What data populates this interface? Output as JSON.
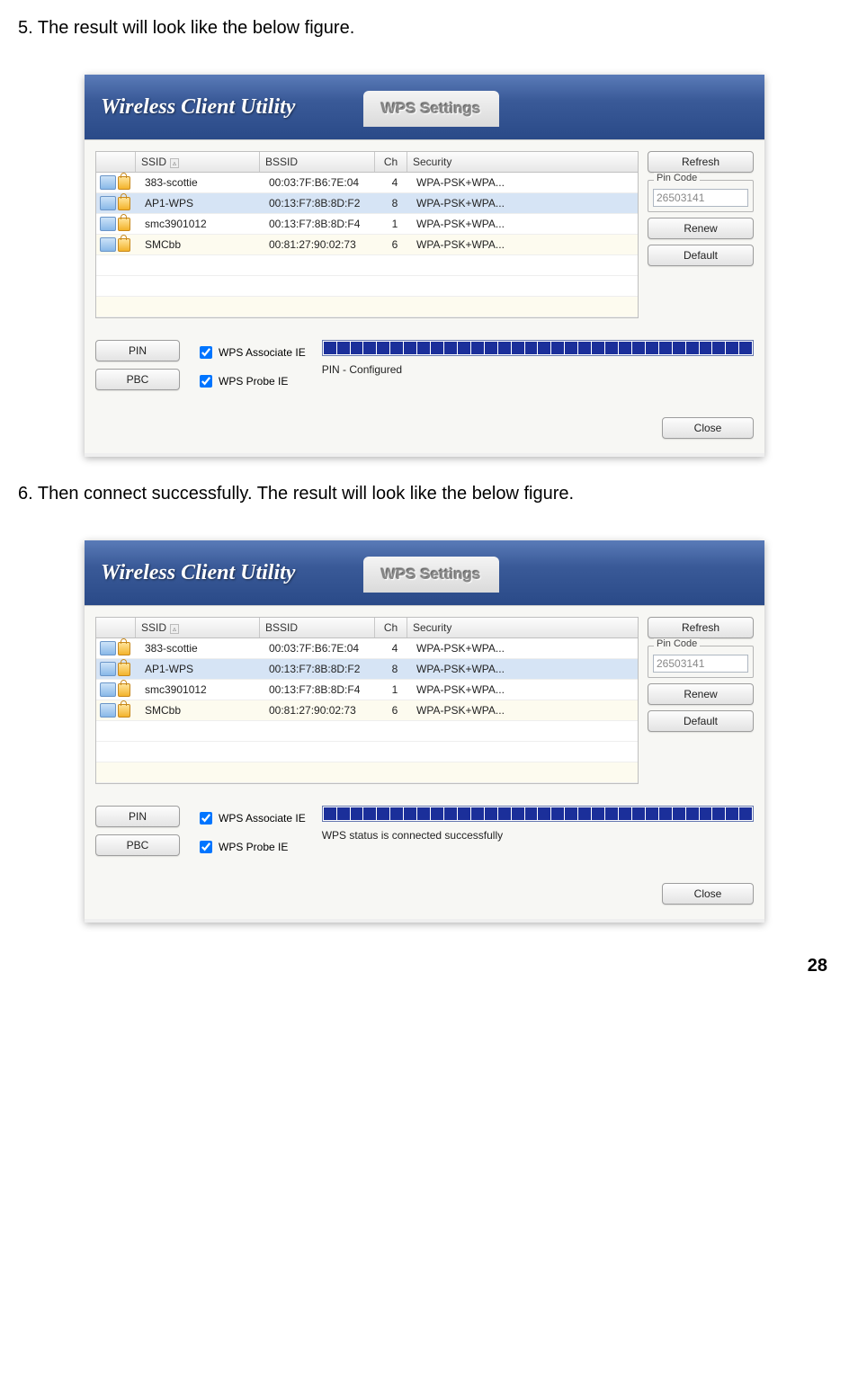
{
  "doc": {
    "step5": "5. The result will look like the below figure.",
    "step6": "6. Then connect successfully. The result will look like the below figure.",
    "page_number": "28"
  },
  "app": {
    "title": "Wireless Client Utility",
    "tab": "WPS Settings"
  },
  "table": {
    "headers": {
      "ssid": "SSID",
      "bssid": "BSSID",
      "ch": "Ch",
      "security": "Security"
    },
    "rows": [
      {
        "ssid": "383-scottie",
        "bssid": "00:03:7F:B6:7E:04",
        "ch": "4",
        "security": "WPA-PSK+WPA..."
      },
      {
        "ssid": "AP1-WPS",
        "bssid": "00:13:F7:8B:8D:F2",
        "ch": "8",
        "security": "WPA-PSK+WPA...",
        "selected": true
      },
      {
        "ssid": "smc3901012",
        "bssid": "00:13:F7:8B:8D:F4",
        "ch": "1",
        "security": "WPA-PSK+WPA..."
      },
      {
        "ssid": "SMCbb",
        "bssid": "00:81:27:90:02:73",
        "ch": "6",
        "security": "WPA-PSK+WPA..."
      }
    ]
  },
  "side": {
    "refresh": "Refresh",
    "pin_legend": "Pin Code",
    "pin_value": "26503141",
    "renew": "Renew",
    "default": "Default"
  },
  "lower": {
    "pin_btn": "PIN",
    "pbc_btn": "PBC",
    "assoc_ie": "WPS Associate IE",
    "probe_ie": "WPS Probe IE",
    "status_configured": "PIN - Configured",
    "status_connected": "WPS status is connected successfully",
    "close": "Close"
  }
}
